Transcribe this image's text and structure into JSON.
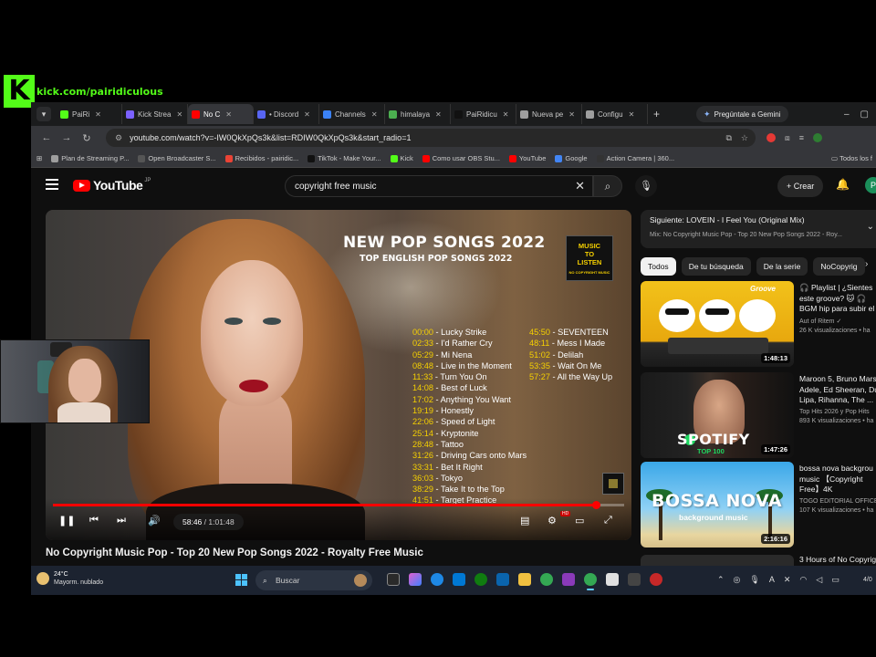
{
  "overlay": {
    "kick_logo_letter": "K",
    "kick_url": "kick.com/pairidiculous"
  },
  "browser": {
    "tabs": [
      {
        "label": "PaiRi",
        "color": "#53fc18",
        "active": false
      },
      {
        "label": "Kick Strea",
        "color": "#7b61ff",
        "active": false
      },
      {
        "label": "No C",
        "color": "#ff0000",
        "active": true
      },
      {
        "label": "• Discord",
        "color": "#5865f2",
        "active": false
      },
      {
        "label": "Channels",
        "color": "#3b82f6",
        "active": false
      },
      {
        "label": "himalaya",
        "color": "#4caf50",
        "active": false
      },
      {
        "label": "PaiRidicu",
        "color": "#111111",
        "active": false
      },
      {
        "label": "Nueva pe",
        "color": "#9e9e9e",
        "active": false
      },
      {
        "label": "Configu",
        "color": "#9e9e9e",
        "active": false
      }
    ],
    "gemini_label": "Pregúntale a Gemini",
    "url": "youtube.com/watch?v=-IW0QkXpQs3k&list=RDIW0QkXpQs3k&start_radio=1",
    "bookmarks": [
      {
        "label": "Plan de Streaming P...",
        "color": "#9e9e9e"
      },
      {
        "label": "Open Broadcaster S...",
        "color": "#555555"
      },
      {
        "label": "Recibidos - pairidic...",
        "color": "#ea4335"
      },
      {
        "label": "TikTok - Make Your...",
        "color": "#111111"
      },
      {
        "label": "Kick",
        "color": "#53fc18"
      },
      {
        "label": "Como usar OBS Stu...",
        "color": "#ff0000"
      },
      {
        "label": "YouTube",
        "color": "#ff0000"
      },
      {
        "label": "Google",
        "color": "#4285f4"
      },
      {
        "label": "Action Camera | 360...",
        "color": "#333333"
      }
    ],
    "all_bookmarks": "Todos los f"
  },
  "youtube": {
    "logo_word": "YouTube",
    "logo_region": "JP",
    "search_value": "copyright free music",
    "create_label": "+ Crear",
    "avatar_letter": "P",
    "video": {
      "overlay_title": "NEW POP SONGS 2022",
      "overlay_subtitle": "TOP ENGLISH POP SONGS 2022",
      "badge_line1": "MUSIC",
      "badge_line2": "TO",
      "badge_line3": "LISTEN",
      "badge_small": "NO COPYRIGHT MUSIC",
      "tracks_left": [
        {
          "time": "00:00",
          "title": "Lucky Strike"
        },
        {
          "time": "02:33",
          "title": "I'd Rather Cry"
        },
        {
          "time": "05:29",
          "title": "Mi Nena"
        },
        {
          "time": "08:48",
          "title": "Live in the Moment"
        },
        {
          "time": "11:33",
          "title": "Turn You On"
        },
        {
          "time": "14:08",
          "title": "Best of Luck"
        },
        {
          "time": "17:02",
          "title": "Anything You Want"
        },
        {
          "time": "19:19",
          "title": "Honestly"
        },
        {
          "time": "22:06",
          "title": "Speed of Light"
        },
        {
          "time": "25:14",
          "title": "Kryptonite"
        },
        {
          "time": "28:48",
          "title": "Tattoo"
        },
        {
          "time": "31:26",
          "title": "Driving Cars onto Mars"
        },
        {
          "time": "33:31",
          "title": "Bet It Right"
        },
        {
          "time": "36:03",
          "title": "Tokyo"
        },
        {
          "time": "38:29",
          "title": "Take It to the Top"
        },
        {
          "time": "41:51",
          "title": "Target Practice"
        }
      ],
      "tracks_right": [
        {
          "time": "45:50",
          "title": "SEVENTEEN"
        },
        {
          "time": "48:11",
          "title": "Mess I Made"
        },
        {
          "time": "51:02",
          "title": "Delilah"
        },
        {
          "time": "53:35",
          "title": "Wait On Me"
        },
        {
          "time": "57:27",
          "title": "All the Way Up"
        }
      ],
      "current_time": "58:46",
      "duration": "1:01:48",
      "progress_fraction": 0.951,
      "hd_badge": "HD",
      "page_title": "No Copyright Music Pop - Top 20 New Pop Songs 2022 - Royalty Free Music"
    },
    "up_next": {
      "line1": "Siguiente: LOVEIN - I Feel You (Original Mix)",
      "line2": "Mix: No Copyright Music Pop - Top 20 New Pop Songs 2022 - Roy..."
    },
    "chips": [
      "Todos",
      "De tu búsqueda",
      "De la serie",
      "NoCopyrig"
    ],
    "recommendations": [
      {
        "title_lines": [
          "🎧 Playlist | ¿Sientes",
          "este groove? 🐱 🎧",
          "BGM hip para subir el"
        ],
        "channel": "Aut of Ritem ✓",
        "views": "26 K visualizaciones • ha",
        "duration": "1:48:13",
        "thumb_text": "Groove"
      },
      {
        "title_lines": [
          "Maroon 5, Bruno Mars",
          "Adele, Ed Sheeran, Du",
          "Lipa, Rihanna, The ..."
        ],
        "channel": "Top Hits 2026 y Pop Hits",
        "views": "893 K visualizaciones • ha",
        "duration": "1:47:26",
        "thumb_text": "SPOTIFY",
        "thumb_sub": "TOP 100"
      },
      {
        "title_lines": [
          "bossa nova backgrou",
          "music 【Copyright",
          "Free】4K"
        ],
        "channel": "TOGO EDITORIAL OFFICE",
        "views": "107 K visualizaciones • ha",
        "duration": "2:16:16",
        "thumb_text": "BOSSA NOVA",
        "thumb_sub": "background music"
      }
    ],
    "rec4_title": "3 Hours of No Copyrig"
  },
  "taskbar": {
    "temp": "24°C",
    "weather": "Mayorm. nublado",
    "search_placeholder": "Buscar",
    "clock": "4/0"
  }
}
